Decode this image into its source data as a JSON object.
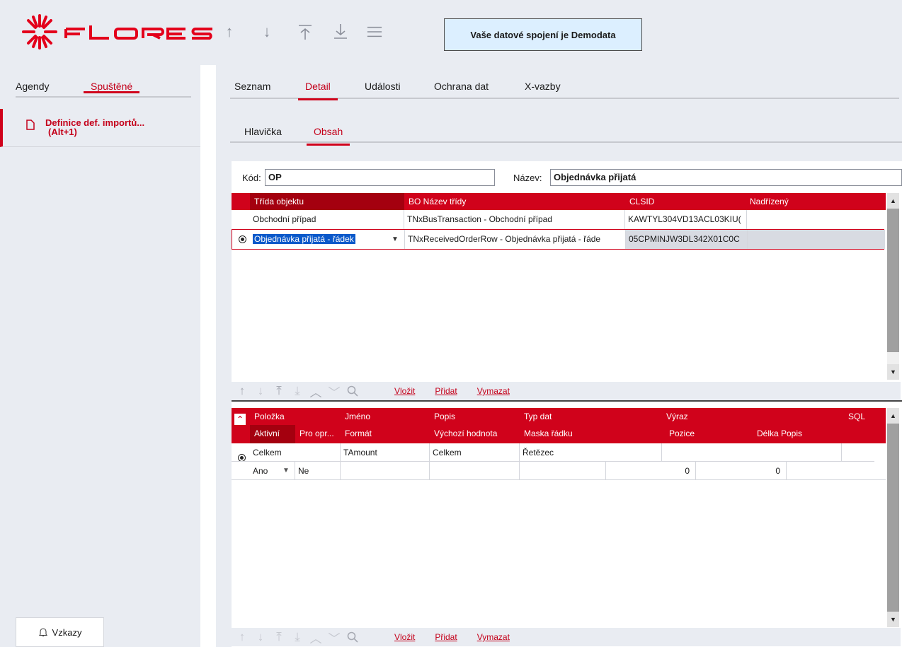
{
  "app": {
    "connection_text": "Vaše datové spojení je Demodata"
  },
  "left": {
    "tab_agendy": "Agendy",
    "tab_spustene": "Spuštěné",
    "doc_title": "Definice def. importů...",
    "doc_shortcut": "(Alt+1)",
    "vzkazy_label": "Vzkazy"
  },
  "main": {
    "tabs": [
      "Seznam",
      "Detail",
      "Události",
      "Ochrana dat",
      "X-vazby"
    ],
    "sub_tabs": [
      "Hlavička",
      "Obsah"
    ]
  },
  "form": {
    "kod_label": "Kód:",
    "kod_value": "OP",
    "nazev_label": "Název:",
    "nazev_value": "Objednávka přijatá"
  },
  "grid1": {
    "headers": [
      "Třída objektu",
      "BO Název třídy",
      "CLSID",
      "Nadřízený"
    ],
    "rows": [
      [
        "Obchodní případ",
        "TNxBusTransaction - Obchodní případ",
        "KAWTYL304VD13ACL03KIU(",
        ""
      ],
      [
        "Objednávka přijatá - řádek",
        "TNxReceivedOrderRow - Objednávka přijatá - řáde",
        "05CPMINJW3DL342X01C0C",
        ""
      ]
    ]
  },
  "grid2": {
    "headers_row1": [
      "Položka",
      "Jméno",
      "Popis",
      "Typ dat",
      "Výraz",
      "SQL"
    ],
    "headers_row2": [
      "Aktivní",
      "Pro opr...",
      "Formát",
      "Výchozí hodnota",
      "Maska řádku",
      "Pozice",
      "Délka",
      "Popis"
    ],
    "row1": [
      "Celkem",
      "TAmount",
      "Celkem",
      "Řetězec"
    ],
    "row2": [
      "Ano",
      "Ne",
      "0",
      "0"
    ]
  },
  "toolbar": {
    "vlozit": "Vložit",
    "pridat": "Přidat",
    "vymazat": "Vymazat"
  },
  "colors": {
    "accent": "#d0021b",
    "accent_dark": "#a4000f",
    "connection_bg": "#dcefff"
  }
}
